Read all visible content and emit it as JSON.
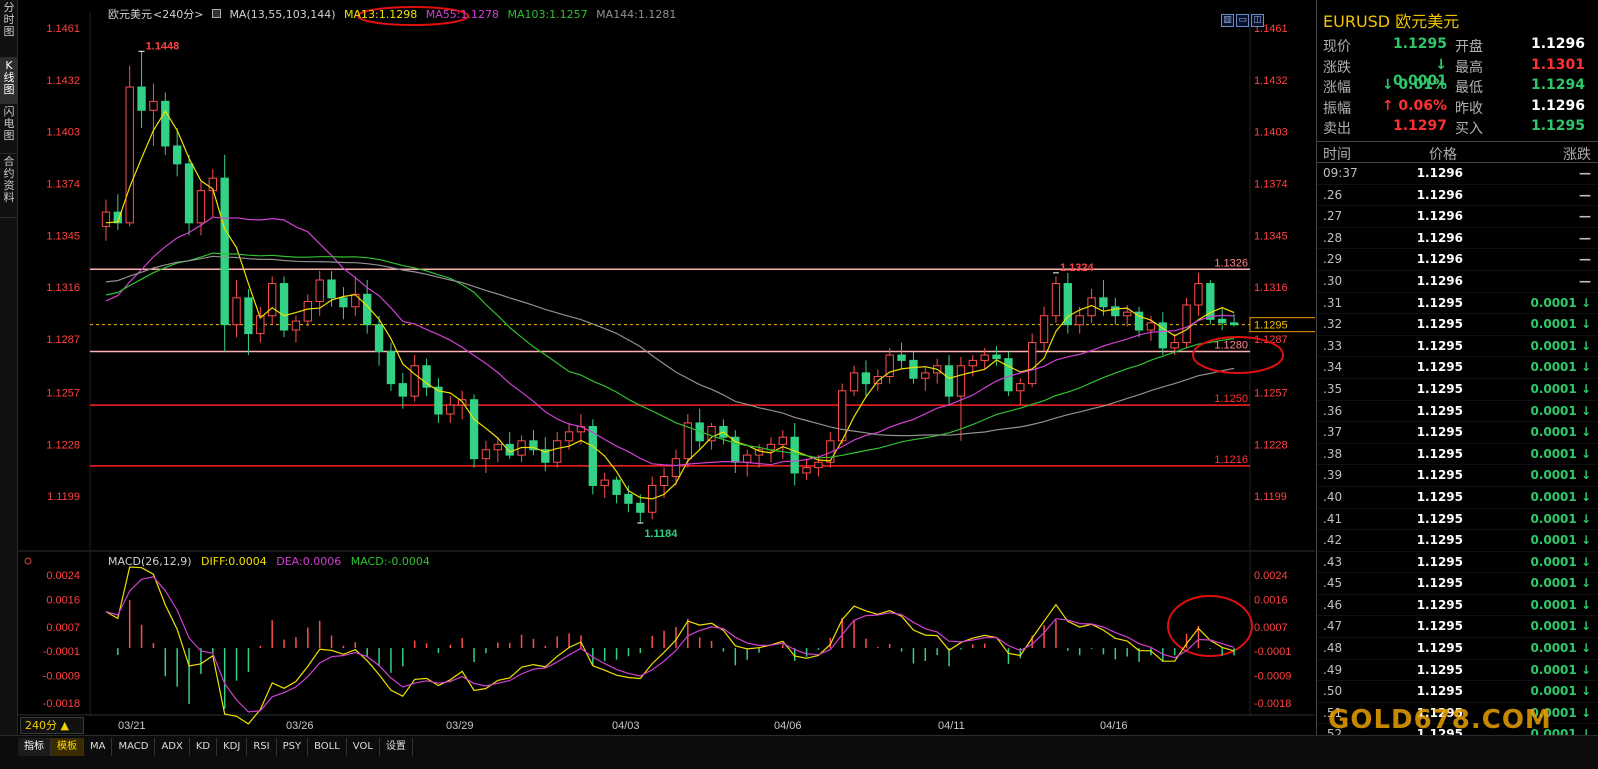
{
  "window": {
    "symbol_name": "欧元美元",
    "period": "<240分>"
  },
  "left_tabs": [
    {
      "label": "分\n时\n图",
      "active": false
    },
    {
      "label": "K\n线\n图",
      "active": true
    },
    {
      "label": "闪\n电\n图",
      "active": false
    },
    {
      "label": "合\n约\n资\n料",
      "active": false
    }
  ],
  "indicator_row": {
    "ma_label": "MA(13,55,103,144)",
    "ma13": "MA13:1.1298",
    "ma55": "MA55:1.1278",
    "ma103": "MA103:1.1257",
    "ma144": "MA144:1.1281",
    "colors": {
      "ma13": "#f0e000",
      "ma55": "#d040d0",
      "ma103": "#30c030",
      "ma144": "#909090",
      "label": "#d0d0d0"
    }
  },
  "price_axis": {
    "ticks": [
      "1.1461",
      "1.1432",
      "1.1403",
      "1.1374",
      "1.1345",
      "1.1316",
      "1.1287",
      "1.1257",
      "1.1228",
      "1.1199"
    ],
    "color": "#ff4040"
  },
  "levels": [
    {
      "label": "1.1326",
      "value": 1.1326,
      "color": "#ffb0b0"
    },
    {
      "label": "1.1280",
      "value": 1.128,
      "color": "#ffb0b0"
    },
    {
      "label": "1.1250",
      "value": 1.125,
      "color": "#ff2020"
    },
    {
      "label": "1.1216",
      "value": 1.1216,
      "color": "#ff2020"
    }
  ],
  "current_price": {
    "label": "1.1295",
    "value": 1.1295
  },
  "annotations": [
    {
      "label": "1.1448",
      "color": "#ff4040"
    },
    {
      "label": "1.1324",
      "color": "#ff4040"
    },
    {
      "label": "1.1184",
      "color": "#30d080"
    }
  ],
  "macd_row": {
    "label": "MACD(26,12,9)",
    "diff": "DIFF:0.0004",
    "dea": "DEA:0.0006",
    "macd": "MACD:-0.0004",
    "colors": {
      "diff": "#f0e000",
      "dea": "#d040d0",
      "macd": "#30c030",
      "label": "#d0d0d0"
    }
  },
  "macd_axis": {
    "ticks": [
      "0.0024",
      "0.0016",
      "0.0007",
      "-0.0001",
      "-0.0009",
      "-0.0018"
    ]
  },
  "date_axis": [
    "03/21",
    "03/26",
    "03/29",
    "04/03",
    "04/06",
    "04/11",
    "04/16"
  ],
  "toolbar_icons": [
    "chart-icon",
    "minimize-icon",
    "restore-icon"
  ],
  "bottom": {
    "period_button": "240分 ▲",
    "tabs": [
      "指标",
      "模板",
      "MA",
      "MACD",
      "ADX",
      "KD",
      "KDJ",
      "RSI",
      "PSY",
      "BOLL",
      "VOL",
      "设置"
    ]
  },
  "quote": {
    "title": "EURUSD 欧元美元",
    "rows": [
      {
        "l1": "现价",
        "v1": "1.1295",
        "c1": "#2ec86a",
        "l2": "开盘",
        "v2": "1.1296",
        "c2": "#ffffff"
      },
      {
        "l1": "涨跌",
        "v1": "↓ 0.0001",
        "c1": "#2ec86a",
        "l2": "最高",
        "v2": "1.1301",
        "c2": "#ff3030"
      },
      {
        "l1": "涨幅",
        "v1": "↓ 0.01%",
        "c1": "#2ec86a",
        "l2": "最低",
        "v2": "1.1294",
        "c2": "#2ec86a"
      },
      {
        "l1": "振幅",
        "v1": "↑ 0.06%",
        "c1": "#ff3030",
        "l2": "昨收",
        "v2": "1.1296",
        "c2": "#ffffff"
      },
      {
        "l1": "卖出",
        "v1": "1.1297",
        "c1": "#ff3030",
        "l2": "买入",
        "v2": "1.1295",
        "c2": "#2ec86a"
      }
    ],
    "tick_headers": {
      "time": "时间",
      "price": "价格",
      "change": "涨跌"
    },
    "ticks": [
      {
        "time": "09:37",
        "price": "1.1296",
        "chg": "—"
      },
      {
        "time": ".26",
        "price": "1.1296",
        "chg": "—"
      },
      {
        "time": ".27",
        "price": "1.1296",
        "chg": "—"
      },
      {
        "time": ".28",
        "price": "1.1296",
        "chg": "—"
      },
      {
        "time": ".29",
        "price": "1.1296",
        "chg": "—"
      },
      {
        "time": ".30",
        "price": "1.1296",
        "chg": "—"
      },
      {
        "time": ".31",
        "price": "1.1295",
        "chg": "0.0001 ↓"
      },
      {
        "time": ".32",
        "price": "1.1295",
        "chg": "0.0001 ↓"
      },
      {
        "time": ".33",
        "price": "1.1295",
        "chg": "0.0001 ↓"
      },
      {
        "time": ".34",
        "price": "1.1295",
        "chg": "0.0001 ↓"
      },
      {
        "time": ".35",
        "price": "1.1295",
        "chg": "0.0001 ↓"
      },
      {
        "time": ".36",
        "price": "1.1295",
        "chg": "0.0001 ↓"
      },
      {
        "time": ".37",
        "price": "1.1295",
        "chg": "0.0001 ↓"
      },
      {
        "time": ".38",
        "price": "1.1295",
        "chg": "0.0001 ↓"
      },
      {
        "time": ".39",
        "price": "1.1295",
        "chg": "0.0001 ↓"
      },
      {
        "time": ".40",
        "price": "1.1295",
        "chg": "0.0001 ↓"
      },
      {
        "time": ".41",
        "price": "1.1295",
        "chg": "0.0001 ↓"
      },
      {
        "time": ".42",
        "price": "1.1295",
        "chg": "0.0001 ↓"
      },
      {
        "time": ".43",
        "price": "1.1295",
        "chg": "0.0001 ↓"
      },
      {
        "time": ".45",
        "price": "1.1295",
        "chg": "0.0001 ↓"
      },
      {
        "time": ".46",
        "price": "1.1295",
        "chg": "0.0001 ↓"
      },
      {
        "time": ".47",
        "price": "1.1295",
        "chg": "0.0001 ↓"
      },
      {
        "time": ".48",
        "price": "1.1295",
        "chg": "0.0001 ↓"
      },
      {
        "time": ".49",
        "price": "1.1295",
        "chg": "0.0001 ↓"
      },
      {
        "time": ".50",
        "price": "1.1295",
        "chg": "0.0001 ↓"
      },
      {
        "time": ".51",
        "price": "1.1295",
        "chg": "0.0001 ↓"
      },
      {
        "time": ".52",
        "price": "1.1295",
        "chg": "0.0001 ↓"
      }
    ]
  },
  "watermark": "GOLD678.COM",
  "chart_data": {
    "type": "candlestick",
    "title": "欧元美元<240分>",
    "y_range": [
      1.117,
      1.147
    ],
    "candles": [
      [
        1.135,
        1.1365,
        1.1342,
        1.1358
      ],
      [
        1.1358,
        1.1368,
        1.1348,
        1.1352
      ],
      [
        1.1352,
        1.144,
        1.135,
        1.1428
      ],
      [
        1.1428,
        1.1448,
        1.1405,
        1.1415
      ],
      [
        1.1415,
        1.143,
        1.1395,
        1.142
      ],
      [
        1.142,
        1.1425,
        1.139,
        1.1395
      ],
      [
        1.1395,
        1.1405,
        1.1378,
        1.1385
      ],
      [
        1.1385,
        1.139,
        1.1345,
        1.1352
      ],
      [
        1.1352,
        1.1375,
        1.1345,
        1.137
      ],
      [
        1.137,
        1.1382,
        1.1355,
        1.1377
      ],
      [
        1.1377,
        1.139,
        1.128,
        1.1295
      ],
      [
        1.1295,
        1.132,
        1.1288,
        1.131
      ],
      [
        1.131,
        1.1315,
        1.1278,
        1.129
      ],
      [
        1.129,
        1.1305,
        1.1285,
        1.13
      ],
      [
        1.13,
        1.1322,
        1.1295,
        1.1318
      ],
      [
        1.1318,
        1.1322,
        1.1288,
        1.1292
      ],
      [
        1.1292,
        1.13,
        1.1285,
        1.1297
      ],
      [
        1.1297,
        1.1312,
        1.1294,
        1.1308
      ],
      [
        1.1308,
        1.1325,
        1.13,
        1.132
      ],
      [
        1.132,
        1.1325,
        1.1305,
        1.131
      ],
      [
        1.131,
        1.1316,
        1.1298,
        1.1305
      ],
      [
        1.1305,
        1.1322,
        1.13,
        1.1312
      ],
      [
        1.1312,
        1.132,
        1.129,
        1.1295
      ],
      [
        1.1295,
        1.13,
        1.1272,
        1.128
      ],
      [
        1.128,
        1.1285,
        1.1258,
        1.1262
      ],
      [
        1.1262,
        1.1268,
        1.1248,
        1.1255
      ],
      [
        1.1255,
        1.1278,
        1.1252,
        1.1272
      ],
      [
        1.1272,
        1.1276,
        1.1255,
        1.126
      ],
      [
        1.126,
        1.1265,
        1.124,
        1.1245
      ],
      [
        1.1245,
        1.1255,
        1.124,
        1.125
      ],
      [
        1.125,
        1.1258,
        1.1242,
        1.1253
      ],
      [
        1.1253,
        1.1256,
        1.1215,
        1.122
      ],
      [
        1.122,
        1.123,
        1.1212,
        1.1225
      ],
      [
        1.1225,
        1.1232,
        1.1218,
        1.1228
      ],
      [
        1.1228,
        1.1235,
        1.122,
        1.1222
      ],
      [
        1.1222,
        1.1233,
        1.1218,
        1.123
      ],
      [
        1.123,
        1.1236,
        1.1222,
        1.1225
      ],
      [
        1.1225,
        1.1232,
        1.1213,
        1.1218
      ],
      [
        1.1218,
        1.1235,
        1.1215,
        1.123
      ],
      [
        1.123,
        1.124,
        1.1225,
        1.1235
      ],
      [
        1.1235,
        1.1245,
        1.1228,
        1.1238
      ],
      [
        1.1238,
        1.1242,
        1.12,
        1.1205
      ],
      [
        1.1205,
        1.1212,
        1.1198,
        1.1208
      ],
      [
        1.1208,
        1.121,
        1.1195,
        1.12
      ],
      [
        1.12,
        1.1205,
        1.119,
        1.1195
      ],
      [
        1.1195,
        1.12,
        1.1184,
        1.119
      ],
      [
        1.119,
        1.121,
        1.1186,
        1.1205
      ],
      [
        1.1205,
        1.1215,
        1.1198,
        1.121
      ],
      [
        1.121,
        1.1225,
        1.1205,
        1.122
      ],
      [
        1.122,
        1.1245,
        1.1215,
        1.124
      ],
      [
        1.124,
        1.1248,
        1.1225,
        1.123
      ],
      [
        1.123,
        1.124,
        1.1225,
        1.1238
      ],
      [
        1.1238,
        1.1242,
        1.1228,
        1.1232
      ],
      [
        1.1232,
        1.1236,
        1.1212,
        1.1218
      ],
      [
        1.1218,
        1.1225,
        1.121,
        1.1222
      ],
      [
        1.1222,
        1.1228,
        1.1215,
        1.1225
      ],
      [
        1.1225,
        1.1232,
        1.1218,
        1.1228
      ],
      [
        1.1228,
        1.1236,
        1.122,
        1.1232
      ],
      [
        1.1232,
        1.124,
        1.1205,
        1.1212
      ],
      [
        1.1212,
        1.122,
        1.1208,
        1.1215
      ],
      [
        1.1215,
        1.1222,
        1.121,
        1.1218
      ],
      [
        1.1218,
        1.1235,
        1.1215,
        1.123
      ],
      [
        1.123,
        1.1262,
        1.1228,
        1.1258
      ],
      [
        1.1258,
        1.1272,
        1.1255,
        1.1268
      ],
      [
        1.1268,
        1.1275,
        1.1255,
        1.1262
      ],
      [
        1.1262,
        1.127,
        1.1258,
        1.1266
      ],
      [
        1.1266,
        1.1282,
        1.1262,
        1.1278
      ],
      [
        1.1278,
        1.1285,
        1.127,
        1.1275
      ],
      [
        1.1275,
        1.128,
        1.1262,
        1.1265
      ],
      [
        1.1265,
        1.1272,
        1.1258,
        1.1268
      ],
      [
        1.1268,
        1.1276,
        1.1262,
        1.1272
      ],
      [
        1.1272,
        1.1278,
        1.125,
        1.1255
      ],
      [
        1.1255,
        1.1277,
        1.123,
        1.1272
      ],
      [
        1.1272,
        1.1278,
        1.1266,
        1.1275
      ],
      [
        1.1275,
        1.1282,
        1.127,
        1.1278
      ],
      [
        1.1278,
        1.1283,
        1.1272,
        1.1276
      ],
      [
        1.1276,
        1.128,
        1.1255,
        1.1258
      ],
      [
        1.1258,
        1.1265,
        1.125,
        1.1262
      ],
      [
        1.1262,
        1.129,
        1.126,
        1.1285
      ],
      [
        1.1285,
        1.1305,
        1.128,
        1.13
      ],
      [
        1.13,
        1.1322,
        1.1296,
        1.1318
      ],
      [
        1.1318,
        1.1324,
        1.129,
        1.1295
      ],
      [
        1.1295,
        1.1305,
        1.129,
        1.13
      ],
      [
        1.13,
        1.1315,
        1.1296,
        1.131
      ],
      [
        1.131,
        1.132,
        1.13,
        1.1305
      ],
      [
        1.1305,
        1.131,
        1.1295,
        1.13
      ],
      [
        1.13,
        1.1306,
        1.1294,
        1.1302
      ],
      [
        1.1302,
        1.1305,
        1.1288,
        1.1292
      ],
      [
        1.1292,
        1.13,
        1.1286,
        1.1296
      ],
      [
        1.1296,
        1.1302,
        1.1278,
        1.1282
      ],
      [
        1.1282,
        1.129,
        1.1278,
        1.1285
      ],
      [
        1.1285,
        1.131,
        1.1282,
        1.1306
      ],
      [
        1.1306,
        1.1324,
        1.13,
        1.1318
      ],
      [
        1.1318,
        1.132,
        1.1295,
        1.1298
      ],
      [
        1.1298,
        1.1304,
        1.1292,
        1.1296
      ],
      [
        1.1296,
        1.1301,
        1.1294,
        1.1295
      ]
    ]
  }
}
